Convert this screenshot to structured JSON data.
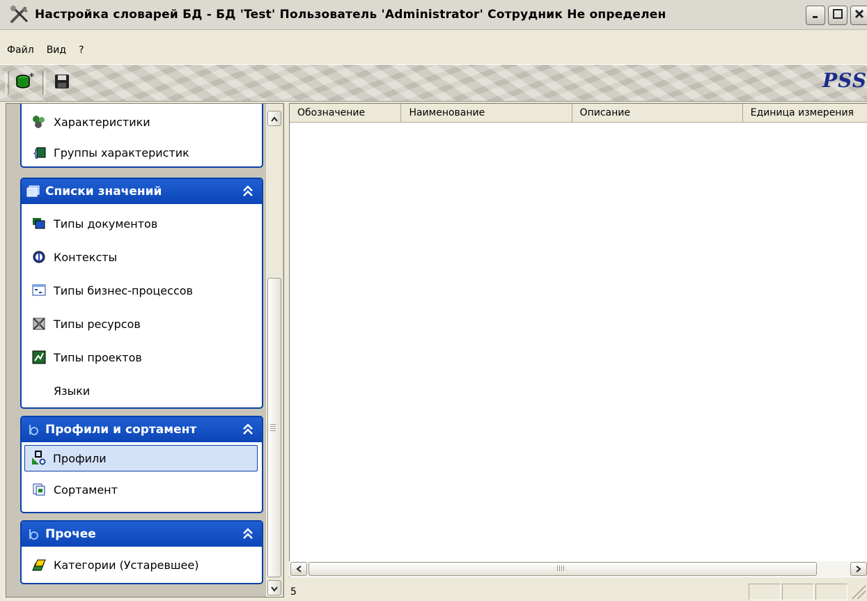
{
  "window": {
    "title": "Настройка словарей БД - БД 'Test' Пользователь 'Administrator' Сотрудник Не определен",
    "icon": "tools-icon",
    "controls": [
      "minimize-icon",
      "maximize-icon",
      "close-icon"
    ]
  },
  "menu": [
    "Файл",
    "Вид",
    "?"
  ],
  "toolbar": {
    "buttons": [
      {
        "icon": "database-new-icon"
      },
      {
        "icon": "save-icon"
      }
    ],
    "brand": "PSS"
  },
  "sidebar": {
    "groups": [
      {
        "title": "",
        "items": [
          {
            "label": "Характеристики",
            "icon": "characteristics-icon"
          },
          {
            "label": "Группы характеристик",
            "icon": "characteristic-groups-icon"
          }
        ]
      },
      {
        "title": "Списки значений",
        "icon": "value-lists-icon",
        "items": [
          {
            "label": "Типы документов",
            "icon": "document-types-icon"
          },
          {
            "label": "Контексты",
            "icon": "contexts-icon"
          },
          {
            "label": "Типы бизнес-процессов",
            "icon": "business-process-types-icon"
          },
          {
            "label": "Типы ресурсов",
            "icon": "resource-types-icon"
          },
          {
            "label": "Типы проектов",
            "icon": "project-types-icon"
          },
          {
            "label": "Языки",
            "icon": ""
          }
        ]
      },
      {
        "title": "Профили и сортамент",
        "icon": "profiles-group-icon",
        "items": [
          {
            "label": "Профили",
            "icon": "profiles-icon",
            "selected": true
          },
          {
            "label": "Сортамент",
            "icon": "assortment-icon"
          }
        ]
      },
      {
        "title": "Прочее",
        "icon": "other-group-icon",
        "items": [
          {
            "label": "Категории (Устаревшее)",
            "icon": "categories-icon"
          }
        ]
      }
    ]
  },
  "table": {
    "columns": [
      "Обозначение",
      "Наименование",
      "Описание",
      "Единица измерения"
    ],
    "rows": []
  },
  "status": {
    "count": "5"
  },
  "colors": {
    "group_header": "#1f5fd2",
    "group_border": "#0a3fa6",
    "selected_bg": "#d4e2f7",
    "brand": "#1c2c8a"
  }
}
